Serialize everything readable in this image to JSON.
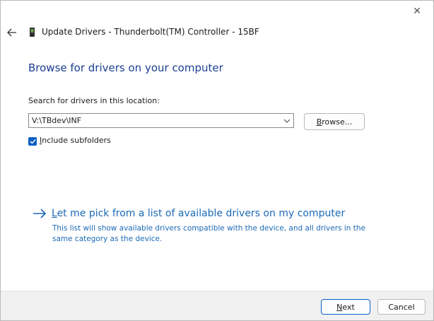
{
  "window": {
    "title": "Update Drivers - Thunderbolt(TM) Controller - 15BF",
    "close_glyph": "✕"
  },
  "page": {
    "heading": "Browse for drivers on your computer"
  },
  "search": {
    "label": "Search for drivers in this location:",
    "value": "V:\\TBdev\\INF",
    "browse_label_mnemonic": "B",
    "browse_label_rest": "rowse..."
  },
  "subfolders": {
    "checked": true,
    "label_mnemonic": "I",
    "label_rest": "nclude subfolders"
  },
  "pick_option": {
    "title_mnemonic": "L",
    "title_rest": "et me pick from a list of available drivers on my computer",
    "description": "This list will show available drivers compatible with the device, and all drivers in the same category as the device."
  },
  "footer": {
    "next_mnemonic": "N",
    "next_rest": "ext",
    "cancel_label": "Cancel"
  },
  "colors": {
    "accent": "#0a5fc2",
    "heading": "#1c3f94",
    "link": "#1c6ab7"
  },
  "icons": {
    "back": "back-arrow-icon",
    "device": "device-icon",
    "close": "close-icon",
    "dropdown": "chevron-down-icon",
    "checkbox": "checkmark-icon",
    "pick": "right-arrow-icon"
  }
}
